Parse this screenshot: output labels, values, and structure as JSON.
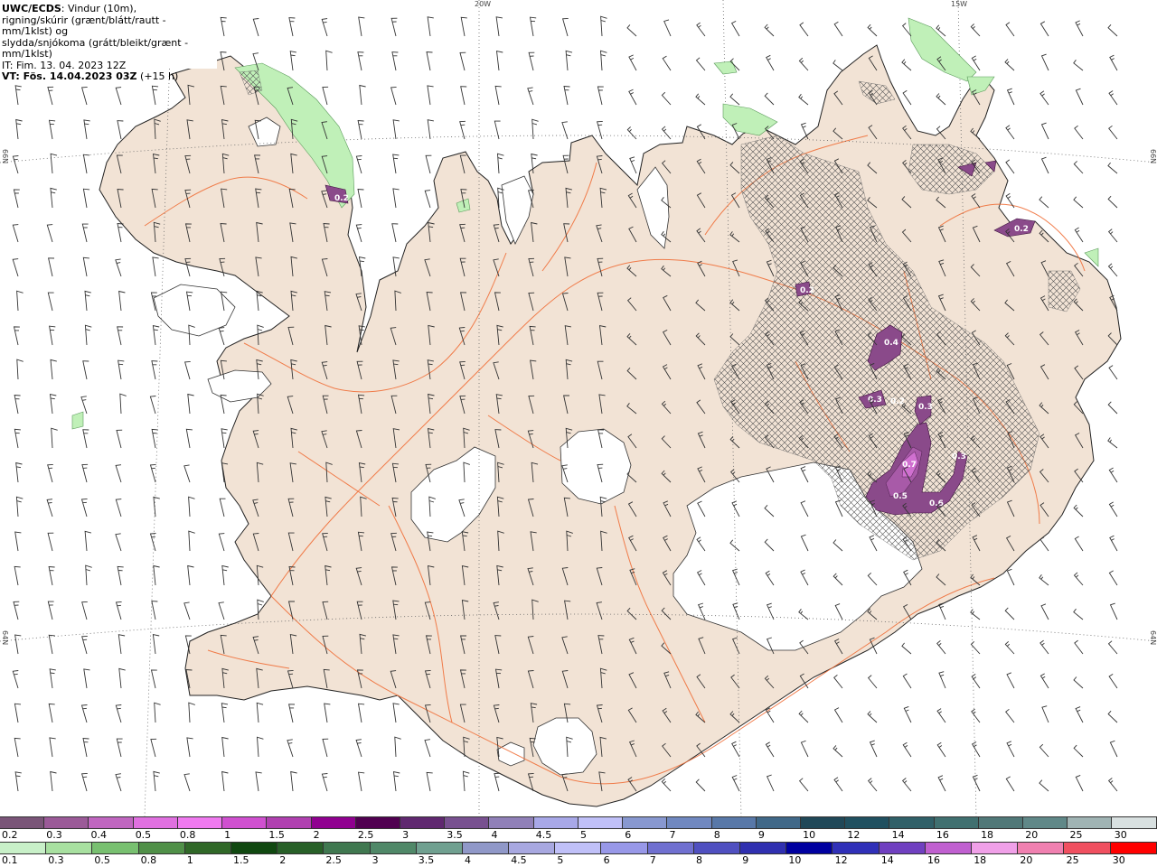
{
  "title": {
    "model": "UWC/ECDS",
    "line1_rest": ": Vindur (10m),",
    "line2": "rigning/skúrir (grænt/blátt/rautt - mm/1klst) og",
    "line3": "slydda/snjókoma (grátt/bleikt/grænt - mm/1klst)",
    "line4": "IT: Fim. 13. 04. 2023 12Z",
    "line5_bold": "VT: Fös. 14.04.2023 03Z",
    "line5_rest": " (+15 h)"
  },
  "grid_labels": {
    "top": [
      "20W",
      "15W"
    ],
    "left": [
      "66N",
      "64N"
    ],
    "right": [
      "66N",
      "64N"
    ]
  },
  "precip_labels": [
    "0.2",
    "0.2",
    "0.2",
    "0.4",
    "0.3",
    "0.2",
    "0.3",
    "0.7",
    "0.3",
    "0.5",
    "0.6"
  ],
  "legend_snow": {
    "labels": [
      "0.2",
      "0.3",
      "0.4",
      "0.5",
      "0.8",
      "1",
      "1.5",
      "2",
      "2.5",
      "3",
      "3.5",
      "4",
      "4.5",
      "5",
      "6",
      "7",
      "8",
      "9",
      "10",
      "12",
      "14",
      "16",
      "18",
      "20",
      "25",
      "30"
    ],
    "colors": [
      "#7a5578",
      "#9b5a98",
      "#c066c0",
      "#e070e0",
      "#f07af0",
      "#d050d0",
      "#b040b0",
      "#900090",
      "#500050",
      "#602870",
      "#785090",
      "#9080b8",
      "#a8a8e8",
      "#c0c0f8",
      "#8898d0",
      "#7088c0",
      "#5878a8",
      "#406888",
      "#204858",
      "#205060",
      "#306068",
      "#407070",
      "#507878",
      "#608888",
      "#a0b4b4",
      "#d8e0e0"
    ]
  },
  "legend_rain": {
    "labels": [
      "0.1",
      "0.3",
      "0.5",
      "0.8",
      "1",
      "1.5",
      "2",
      "2.5",
      "3",
      "3.5",
      "4",
      "4.5",
      "5",
      "6",
      "7",
      "8",
      "9",
      "10",
      "12",
      "14",
      "16",
      "18",
      "20",
      "25",
      "30"
    ],
    "colors": [
      "#c8f0c8",
      "#a8e0a0",
      "#78c070",
      "#509048",
      "#306828",
      "#104810",
      "#286028",
      "#407850",
      "#508868",
      "#70a090",
      "#9098c8",
      "#a8a8e0",
      "#c0c0f8",
      "#9898e8",
      "#7070d0",
      "#5050c0",
      "#3030b0",
      "#0000a0",
      "#3030b8",
      "#7040c0",
      "#c060d0",
      "#f0a0e8",
      "#f080b0",
      "#f05060",
      "#ff0000"
    ]
  },
  "colors": {
    "land": "#f2e3d5",
    "coast": "#222222",
    "roads": "#f0703a",
    "rain_light": "#c0f0b8",
    "snow_heavy": "#6a2a70",
    "wind_barb": "#333333"
  }
}
